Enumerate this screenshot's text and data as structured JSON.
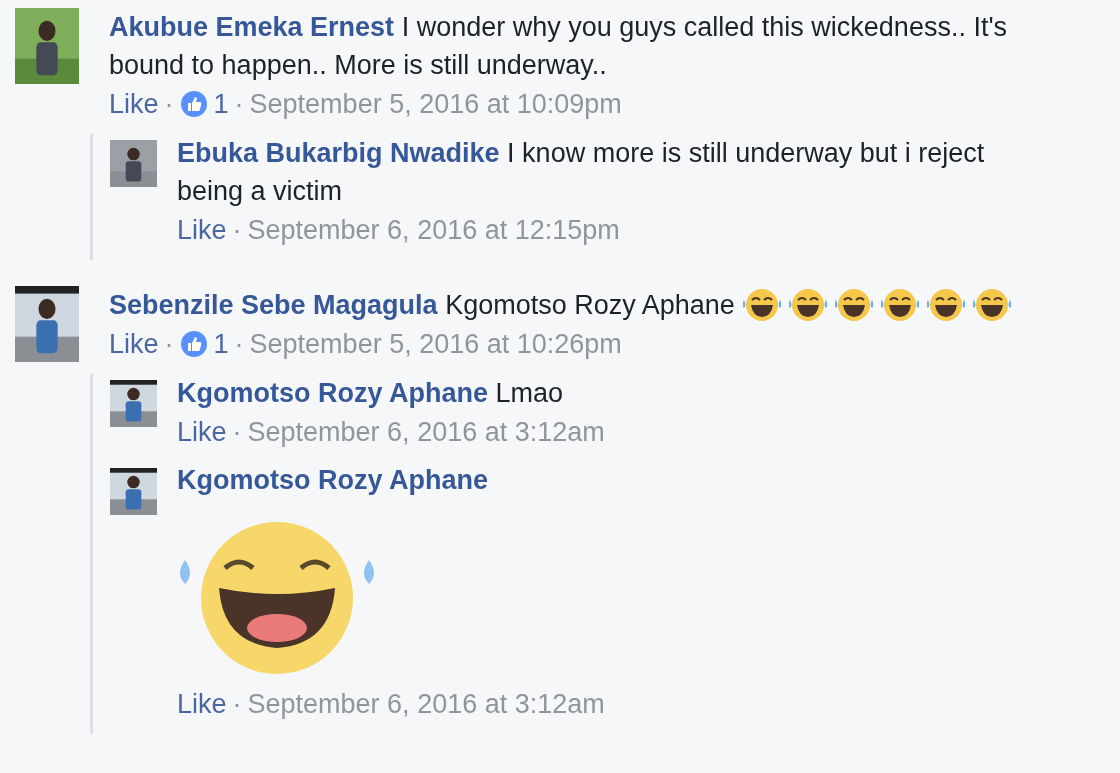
{
  "comments": [
    {
      "author": "Akubue Emeka Ernest",
      "text": "I wonder why you guys called this wickedness.. It's bound to happen.. More is still underway..",
      "like_label": "Like",
      "separator": "·",
      "likes": "1",
      "time": "September 5, 2016 at 10:09pm",
      "replies": [
        {
          "author": "Ebuka Bukarbig Nwadike",
          "text": "I know more is still underway but i reject being a victim",
          "kind": "text",
          "like_label": "Like",
          "separator": "·",
          "time": "September 6, 2016 at 12:15pm"
        }
      ]
    },
    {
      "author": "Sebenzile Sebe Magagula",
      "text": "Kgomotso Rozy Aphane",
      "emojis": [
        {
          "kind": "laughing"
        },
        {
          "kind": "laughing"
        },
        {
          "kind": "laughing"
        },
        {
          "kind": "laughing"
        },
        {
          "kind": "laughing"
        },
        {
          "kind": "laughing"
        }
      ],
      "like_label": "Like",
      "separator": "·",
      "likes": "1",
      "time": "September 5, 2016 at 10:26pm",
      "replies": [
        {
          "author": "Kgomotso Rozy Aphane",
          "text": "Lmao",
          "kind": "text",
          "like_label": "Like",
          "separator": "·",
          "time": "September 6, 2016 at 3:12am"
        },
        {
          "author": "Kgomotso Rozy Aphane",
          "kind": "sticker",
          "like_label": "Like",
          "separator": "·",
          "time": "September 6, 2016 at 3:12am"
        }
      ]
    }
  ]
}
